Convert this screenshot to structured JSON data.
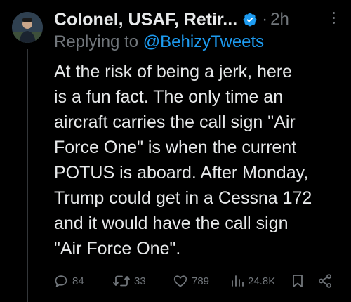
{
  "tweet": {
    "display_name": "Colonel, USAF, Retir...",
    "separator": "·",
    "time": "2h",
    "replying_prefix": "Replying to",
    "replying_handle": "@BehizyTweets",
    "text": "At the risk of being a jerk, here\nis a fun fact. The only time an\naircraft carries the call sign \"Air\nForce One\" is when the current\nPOTUS is aboard. After Monday,\nTrump could get in a Cessna 172\nand it would have the call sign\n\"Air Force One\"."
  },
  "actions": {
    "replies": "84",
    "reposts": "33",
    "likes": "789",
    "views": "24.8K"
  },
  "icons": {
    "verified": "verified-badge-icon",
    "more": "more-options-icon",
    "reply": "reply-icon",
    "repost": "repost-icon",
    "like": "heart-icon",
    "views": "views-icon",
    "bookmark": "bookmark-icon",
    "share": "share-icon"
  },
  "colors": {
    "background": "#000000",
    "text": "#e7e9ea",
    "muted": "#71767b",
    "accent": "#1d9bf0"
  }
}
